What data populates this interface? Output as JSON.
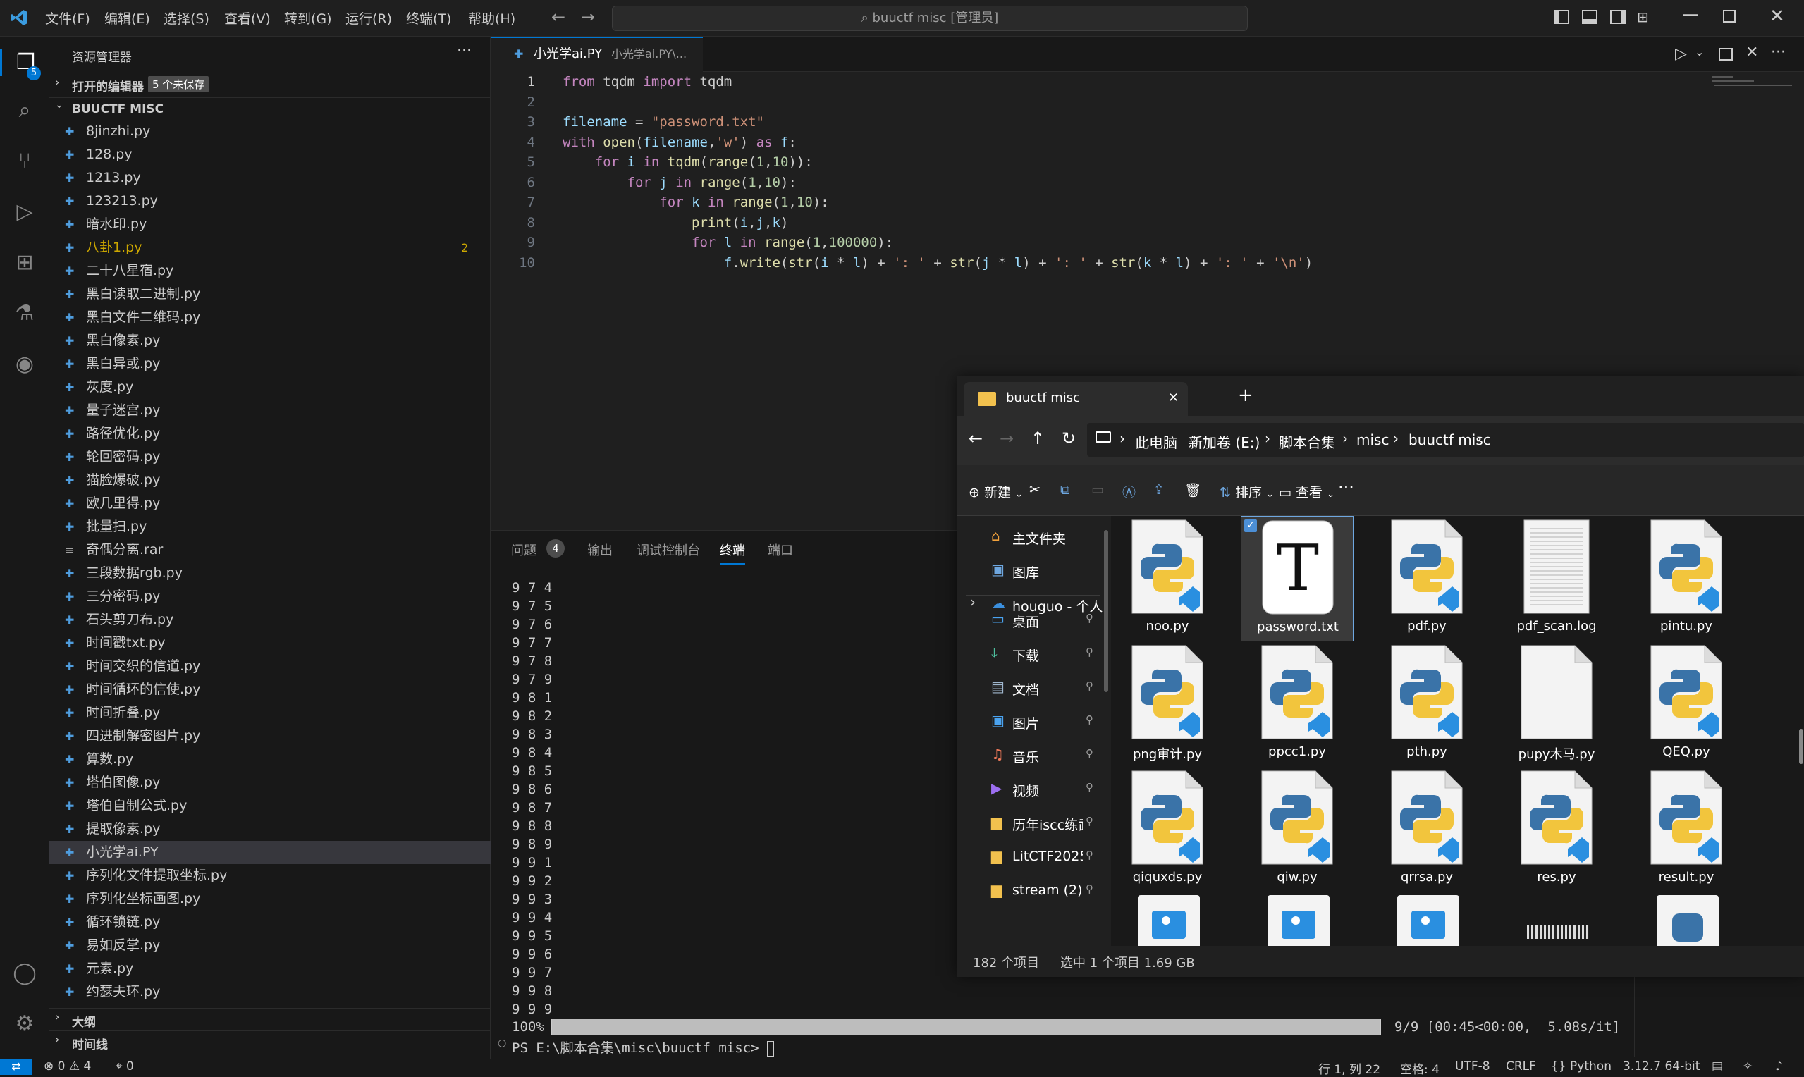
{
  "titlebar": {
    "menus": [
      "文件(F)",
      "编辑(E)",
      "选择(S)",
      "查看(V)",
      "转到(G)",
      "运行(R)",
      "终端(T)",
      "帮助(H)"
    ],
    "search": "buuctf misc [管理员]"
  },
  "activity": {
    "badge": "5"
  },
  "sidebar": {
    "title": "资源管理器",
    "open_editors": "打开的编辑器",
    "unsaved": "5 个未保存",
    "folder": "BUUCTF MISC",
    "files": [
      "8jinzhi.py",
      "128.py",
      "1213.py",
      "123213.py",
      "暗水印.py",
      "八卦1.py",
      "二十八星宿.py",
      "黑白读取二进制.py",
      "黑白文件二维码.py",
      "黑白像素.py",
      "黑白异或.py",
      "灰度.py",
      "量子迷宫.py",
      "路径优化.py",
      "轮回密码.py",
      "猫脸爆破.py",
      "欧几里得.py",
      "批量扫.py",
      "奇偶分离.rar",
      "三段数据rgb.py",
      "三分密码.py",
      "石头剪刀布.py",
      "时间戳txt.py",
      "时间交织的信道.py",
      "时间循环的信使.py",
      "时间折叠.py",
      "四进制解密图片.py",
      "算数.py",
      "塔伯图像.py",
      "塔伯自制公式.py",
      "提取像素.py",
      "小光学ai.PY",
      "序列化文件提取坐标.py",
      "序列化坐标画图.py",
      "循环锁链.py",
      "易如反掌.py",
      "元素.py",
      "约瑟夫环.py"
    ],
    "warn_count": "2",
    "outline": "大纲",
    "timeline": "时间线"
  },
  "editor": {
    "tab_name": "小光学ai.PY",
    "tab_path": "小光学ai.PY\\...",
    "line_numbers": [
      "1",
      "2",
      "3",
      "4",
      "5",
      "6",
      "7",
      "8",
      "9",
      "10"
    ]
  },
  "panel": {
    "tabs": [
      "问题",
      "输出",
      "调试控制台",
      "终端",
      "端口"
    ],
    "problems_count": "4",
    "terminal_lines": [
      "9 7 4",
      "9 7 5",
      "9 7 6",
      "9 7 7",
      "9 7 8",
      "9 7 9",
      "9 8 1",
      "9 8 2",
      "9 8 3",
      "9 8 4",
      "9 8 5",
      "9 8 6",
      "9 8 7",
      "9 8 8",
      "9 8 9",
      "9 9 1",
      "9 9 2",
      "9 9 3",
      "9 9 4",
      "9 9 5",
      "9 9 6",
      "9 9 7",
      "9 9 8",
      "9 9 9"
    ],
    "progress_pct": "100%",
    "progress_tail": "9/9 [00:45<00:00,  5.08s/it]",
    "prompt": "PS E:\\脚本合集\\misc\\buuctf misc> "
  },
  "status": {
    "errors": "0",
    "warnings": "4",
    "ports": "0",
    "position": "行 1, 列 22",
    "spaces": "空格: 4",
    "encoding": "UTF-8",
    "eol": "CRLF",
    "language": "Python",
    "interpreter": "3.12.7 64-bit"
  },
  "explorer": {
    "tab_title": "buuctf misc",
    "breadcrumb": [
      "此电脑",
      "新加卷 (E:)",
      "脚本合集",
      "misc",
      "buuctf misc"
    ],
    "toolbar": {
      "new": "新建",
      "sort": "排序",
      "view": "查看"
    },
    "nav_top": [
      "主文件夹",
      "图库",
      "houguo - 个人"
    ],
    "nav_pinned": [
      "桌面",
      "下载",
      "文档",
      "图片",
      "音乐",
      "视频",
      "历年iscc练武",
      "LitCTF2025v",
      "stream (2)"
    ],
    "files_row1": [
      "noo.py",
      "password.txt",
      "pdf.py",
      "pdf_scan.log",
      "pintu.py"
    ],
    "files_row2": [
      "png审计.py",
      "ppcc1.py",
      "pth.py",
      "pupy木马.py",
      "QEQ.py"
    ],
    "files_row3": [
      "qiquxds.py",
      "qiw.py",
      "qrrsa.py",
      "res.py",
      "result.py"
    ],
    "item_count": "182 个项目",
    "selection": "选中 1 个项目  1.69 GB"
  }
}
